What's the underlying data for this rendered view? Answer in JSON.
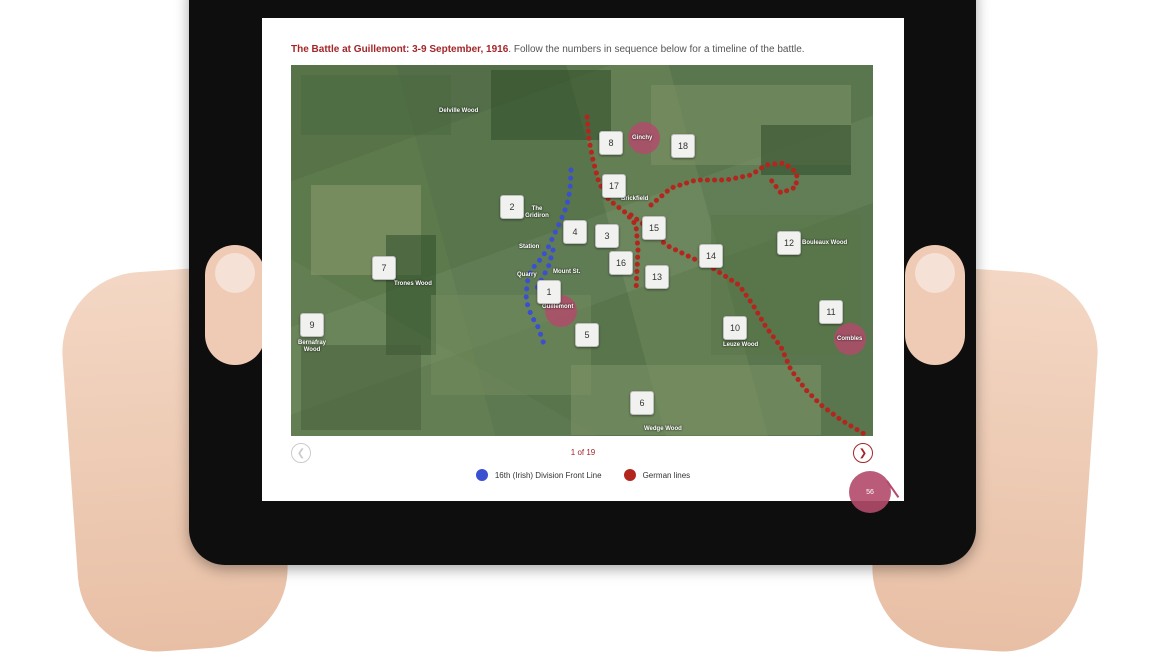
{
  "header": {
    "title_red": "The Battle at Guillemont: 3-9 September, 1916",
    "title_rest": ". Follow the numbers in sequence below for a timeline of the battle."
  },
  "map": {
    "labels": {
      "delville": "Delville Wood",
      "ginchy": "Ginchy",
      "gridiron": "The Gridiron",
      "brickfield": "Brickfield",
      "station": "Station",
      "quarry": "Quarry",
      "mount_st": "Mount St.",
      "guillemont": "Guillemont",
      "trones": "Trones Wood",
      "bernafray": "Bernafray Wood",
      "bouleaux": "Bouleaux Wood",
      "leuze": "Leuze Wood",
      "combles": "Combles",
      "wedge": "Wedge Wood"
    },
    "markers": [
      "1",
      "2",
      "3",
      "4",
      "5",
      "6",
      "7",
      "8",
      "9",
      "10",
      "11",
      "12",
      "13",
      "14",
      "15",
      "16",
      "17",
      "18"
    ]
  },
  "pager": {
    "prev_icon": "chevron-left-icon",
    "next_icon": "chevron-right-icon",
    "status": "1 of 19"
  },
  "legend": {
    "blue_label": "16th (Irish) Division Front Line",
    "red_label": "German lines",
    "blue_color": "#3b4fd1",
    "red_color": "#b3261e"
  },
  "corner": {
    "page_label": "56"
  }
}
